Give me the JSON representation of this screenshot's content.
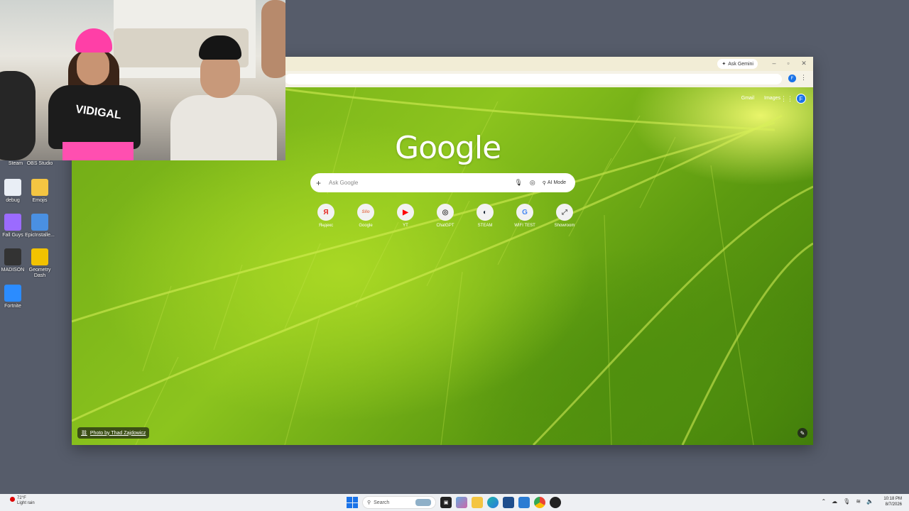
{
  "desktop_icons": [
    {
      "label": "Steam",
      "color": "#1b2838"
    },
    {
      "label": "OBS Studio",
      "color": "#3b3b3b"
    },
    {
      "label": "debug",
      "color": "#e9eef5"
    },
    {
      "label": "Emojis",
      "color": "#f4c542"
    },
    {
      "label": "Fall Guys",
      "color": "#9b6bff"
    },
    {
      "label": "EpicInstalle...",
      "color": "#4a90e2"
    },
    {
      "label": "MADISON",
      "color": "#333333"
    },
    {
      "label": "Geometry Dash",
      "color": "#f2c200"
    },
    {
      "label": "Fortnite",
      "color": "#2b8cff"
    }
  ],
  "browser": {
    "ask_gemini_label": "Ask Gemini",
    "profile_initial": "F",
    "top_links": [
      "Gmail",
      "Images"
    ],
    "avatar_initial": "F",
    "logo_text": "Google",
    "search_placeholder": "Ask Google",
    "ai_mode_label": "AI Mode",
    "shortcuts": [
      {
        "label": "Яндекс",
        "glyph": "Я",
        "color": "#e52620"
      },
      {
        "label": "Google",
        "glyph": "Silo",
        "color": "#e57a5a"
      },
      {
        "label": "YT",
        "glyph": "▶",
        "color": "#ff0000"
      },
      {
        "label": "ChatGPT",
        "glyph": "◎",
        "color": "#444444"
      },
      {
        "label": "STEAM",
        "glyph": "◐",
        "color": "#1b2838"
      },
      {
        "label": "WIFI TEST",
        "glyph": "G",
        "color": "#4285f4"
      },
      {
        "label": "Showroom",
        "glyph": "⤢",
        "color": "#666666"
      }
    ],
    "photo_credit": "Photo by Thad Zajdowicz"
  },
  "webcam": {
    "shirt_text": "VIDIGAL"
  },
  "taskbar": {
    "weather_temp": "72°F",
    "weather_desc": "Light rain",
    "search_label": "Search",
    "time": "10:18 PM",
    "date": "8/7/2026"
  }
}
